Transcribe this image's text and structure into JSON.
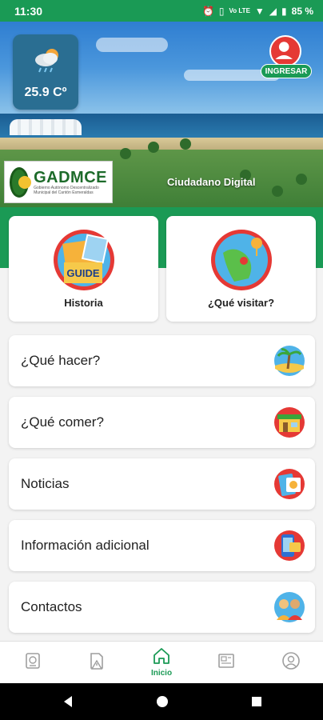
{
  "status_bar": {
    "time": "11:30",
    "battery": "85 %",
    "network": "Vo LTE"
  },
  "header": {
    "temperature": "25.9 Cº",
    "login_label": "INGRESAR",
    "logo_name": "GADMCE",
    "logo_subtitle": "Gobierno Autónomo Descentralizado Municipal del Cantón Esmeraldas",
    "app_subtitle": "Ciudadano Digital"
  },
  "featured": [
    {
      "label": "Historia",
      "icon": "guide-book-icon",
      "icon_text": "GUIDE"
    },
    {
      "label": "¿Qué visitar?",
      "icon": "map-pin-icon"
    }
  ],
  "menu": [
    {
      "label": "¿Qué hacer?",
      "icon": "beach-palm-icon"
    },
    {
      "label": "¿Qué comer?",
      "icon": "restaurant-icon"
    },
    {
      "label": "Noticias",
      "icon": "news-icon"
    },
    {
      "label": "Información adicional",
      "icon": "info-phone-icon"
    },
    {
      "label": "Contactos",
      "icon": "contacts-icon"
    }
  ],
  "bottom_nav": {
    "active_label": "Inicio",
    "items": [
      "passport-icon",
      "document-alert-icon",
      "home-icon",
      "newspaper-icon",
      "profile-icon"
    ]
  },
  "colors": {
    "brand_green": "#1a9a55",
    "accent_red": "#e53935"
  }
}
